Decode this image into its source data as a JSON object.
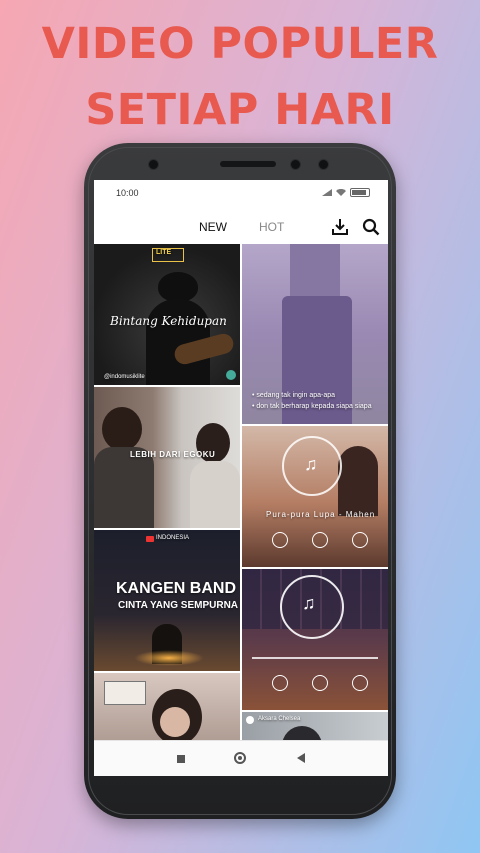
{
  "headline": {
    "line1": "VIDEO POPULER",
    "line2": "SETIAP HARI"
  },
  "status_bar": {
    "time": "10:00"
  },
  "tabs": [
    {
      "label": "NEW",
      "active": true
    },
    {
      "label": "HOT",
      "active": false
    }
  ],
  "toolbar": {
    "download_icon": "download-icon",
    "search_icon": "search-icon"
  },
  "feed": {
    "tile1": {
      "badge": "LITE",
      "script": "Bintang Kehidupan",
      "handle": "@indomusiklite"
    },
    "tile2": {
      "title": "LEBIH DARI EGOKU"
    },
    "tile3": {
      "channel": "INDONESIA",
      "title": "KANGEN BAND",
      "subtitle": "CINTA YANG SEMPURNA"
    },
    "tile5": {
      "line1": "• sedang tak ingin apa-apa",
      "line2": "• don tak berharap kepada siapa siapa"
    },
    "tile6": {
      "caption": "Pura-pura Lupa - Mahen"
    },
    "tile8": {
      "caption": "Aksara Chelsea"
    }
  },
  "colors": {
    "headline": "#e85a4f",
    "accent_bg_left": "#f6a7b2",
    "accent_bg_right": "#8fc6f3"
  }
}
